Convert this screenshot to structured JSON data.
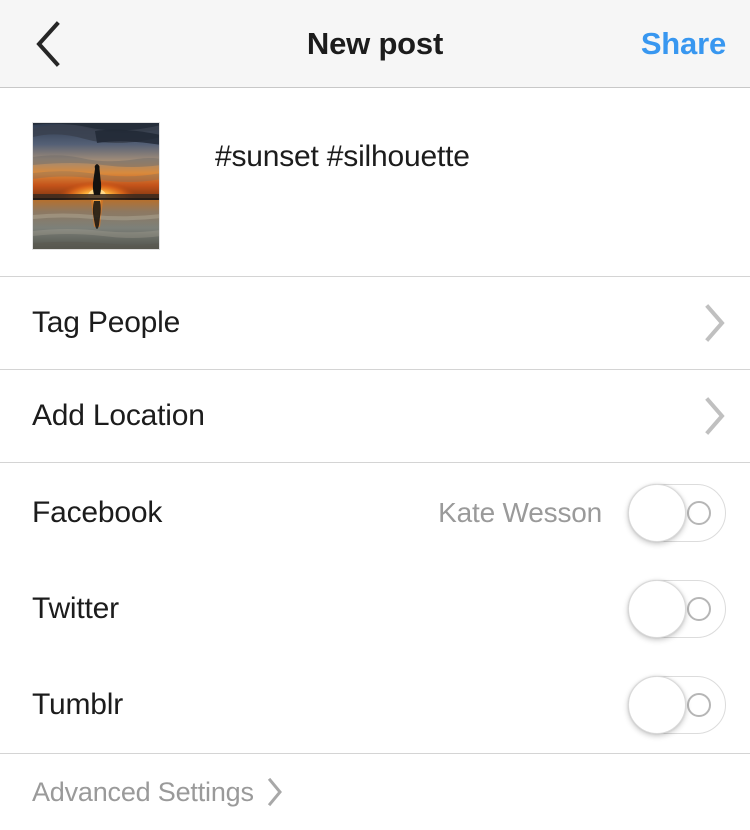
{
  "header": {
    "back_icon": "chevron-left-icon",
    "title": "New post",
    "share_label": "Share",
    "share_color": "#3897f0",
    "background": "#f6f6f6"
  },
  "caption": {
    "text": "#sunset #silhouette",
    "thumbnail_alt": "sunset silhouette photo"
  },
  "nav_rows": [
    {
      "label": "Tag People",
      "icon": "chevron-right-icon"
    },
    {
      "label": "Add Location",
      "icon": "chevron-right-icon"
    }
  ],
  "social": [
    {
      "label": "Facebook",
      "account": "Kate Wesson",
      "enabled": false
    },
    {
      "label": "Twitter",
      "account": "",
      "enabled": false
    },
    {
      "label": "Tumblr",
      "account": "",
      "enabled": false
    }
  ],
  "footer": {
    "label": "Advanced Settings",
    "icon": "chevron-right-icon"
  }
}
